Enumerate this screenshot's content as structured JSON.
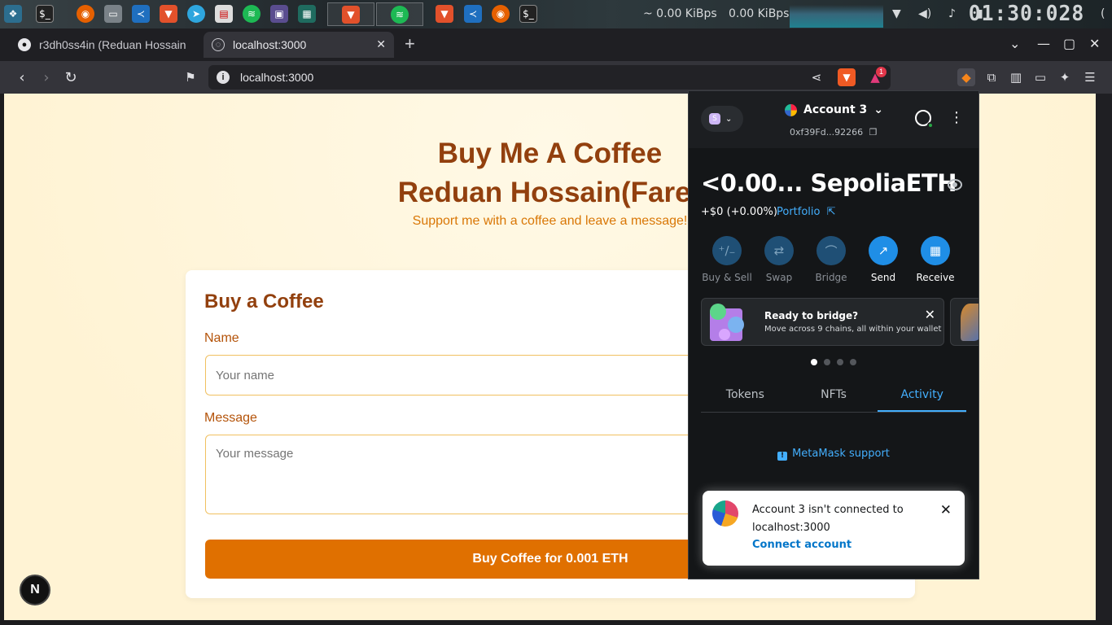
{
  "taskbar": {
    "net_speed_up": "~ 0.00 KiBps",
    "net_speed_down": "0.00 KiBps",
    "clock": "01:30:028"
  },
  "browser": {
    "tabs": [
      {
        "label": "r3dh0ss4in (Reduan Hossain",
        "active": false
      },
      {
        "label": "localhost:3000",
        "active": true
      }
    ],
    "new_tab": "+",
    "url": "localhost:3000",
    "notification_count": "1"
  },
  "page": {
    "title_line1": "Buy Me A Coffee",
    "title_line2": "Reduan Hossain(Farer",
    "subtitle": "Support me with a coffee and leave a message!",
    "card_title": "Buy a Coffee",
    "name_label": "Name",
    "name_placeholder": "Your name",
    "message_label": "Message",
    "message_placeholder": "Your message",
    "buy_button": "Buy Coffee for 0.001 ETH",
    "next_badge": "N"
  },
  "metamask": {
    "account_name": "Account 3",
    "address": "0xf39Fd...92266",
    "balance": "<0.00... SepoliaETH",
    "change": "+$0 (+0.00%)",
    "portfolio": "Portfolio",
    "actions": [
      {
        "label": "Buy & Sell",
        "icon": "buy-sell-icon",
        "enabled": false
      },
      {
        "label": "Swap",
        "icon": "swap-icon",
        "enabled": false
      },
      {
        "label": "Bridge",
        "icon": "bridge-icon",
        "enabled": false
      },
      {
        "label": "Send",
        "icon": "send-icon",
        "enabled": true
      },
      {
        "label": "Receive",
        "icon": "receive-icon",
        "enabled": true
      }
    ],
    "banner_title": "Ready to bridge?",
    "banner_text": "Move across 9 chains, all within your wallet",
    "tabs": [
      "Tokens",
      "NFTs",
      "Activity"
    ],
    "active_tab": "Activity",
    "support_link": "MetaMask support",
    "toast_message": "Account 3 isn't connected to localhost:3000",
    "toast_link": "Connect account",
    "colors": {
      "accent": "#43aefc",
      "panel": "#141618"
    }
  },
  "colors": {
    "brand": "#92400e",
    "button": "#e07000",
    "page_bg": "#fff6dc"
  }
}
